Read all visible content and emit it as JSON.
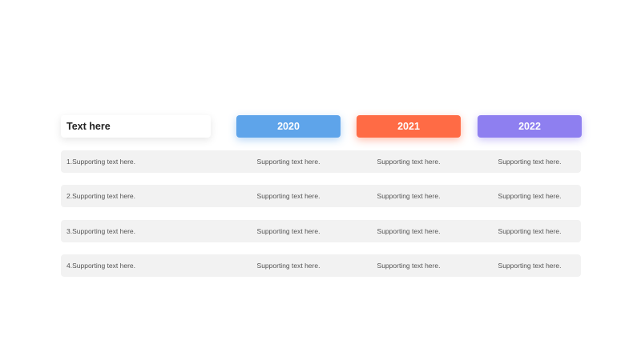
{
  "header": {
    "title": "Text here",
    "years": [
      "2020",
      "2021",
      "2022"
    ]
  },
  "colors": {
    "year_2020": "#5ea4ea",
    "year_2021": "#ff6b45",
    "year_2022": "#8e7ff0",
    "row_background": "#f2f2f2"
  },
  "rows": [
    {
      "label": "1.Supporting text here.",
      "cells": [
        "Supporting text here.",
        "Supporting text here.",
        "Supporting text here."
      ]
    },
    {
      "label": "2.Supporting text here.",
      "cells": [
        "Supporting text here.",
        "Supporting text here.",
        "Supporting text here."
      ]
    },
    {
      "label": "3.Supporting text here.",
      "cells": [
        "Supporting text here.",
        "Supporting text here.",
        "Supporting text here."
      ]
    },
    {
      "label": "4.Supporting text here.",
      "cells": [
        "Supporting text here.",
        "Supporting text here.",
        "Supporting text here."
      ]
    }
  ]
}
